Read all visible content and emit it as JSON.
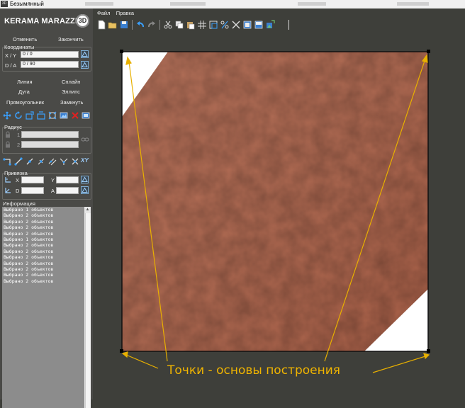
{
  "window": {
    "app_icon": "3D",
    "title": "Безымянный"
  },
  "logo": {
    "brand": "KERAMA MARAZZI",
    "badge": "3D"
  },
  "history": {
    "undo_label": "Отменить",
    "finish_label": "Закончить"
  },
  "coords": {
    "title": "Координаты",
    "xy_label": "X / Y",
    "xy_value": "0 / 0",
    "da_label": "D / A",
    "da_value": "0 / 90"
  },
  "draw": {
    "line": "Линия",
    "spline": "Сплайн",
    "arc": "Дуга",
    "ellipse": "Эллипс",
    "rect": "Прямоугольник",
    "close": "Замкнуть"
  },
  "radius": {
    "title": "Радиус",
    "r1": "1",
    "r2": "2"
  },
  "snap": {
    "title": "Привязка",
    "x": "X",
    "y": "Y",
    "d": "D",
    "a": "A",
    "xy_button": "XY"
  },
  "info": {
    "title": "Информация",
    "lines": [
      "Выбрано 1 объектов",
      "Выбрано 2 объектов",
      "Выбрано 2 объектов",
      "Выбрано 2 объектов",
      "Выбрано 2 объектов",
      "Выбрано 1 объектов",
      "Выбрано 2 объектов",
      "Выбрано 2 объектов",
      "Выбрано 2 объектов",
      "Выбрано 2 объектов",
      "Выбрано 2 объектов",
      "Выбрано 2 объектов",
      "Выбрано 2 объектов"
    ]
  },
  "menu": {
    "file": "Файл",
    "edit": "Правка"
  },
  "annotation": "Точки - основы построения",
  "colors": {
    "tile": "#b56e55",
    "highlight": "#f0b400",
    "panel": "#4a4a47",
    "workspace": "#3e3f3a"
  }
}
